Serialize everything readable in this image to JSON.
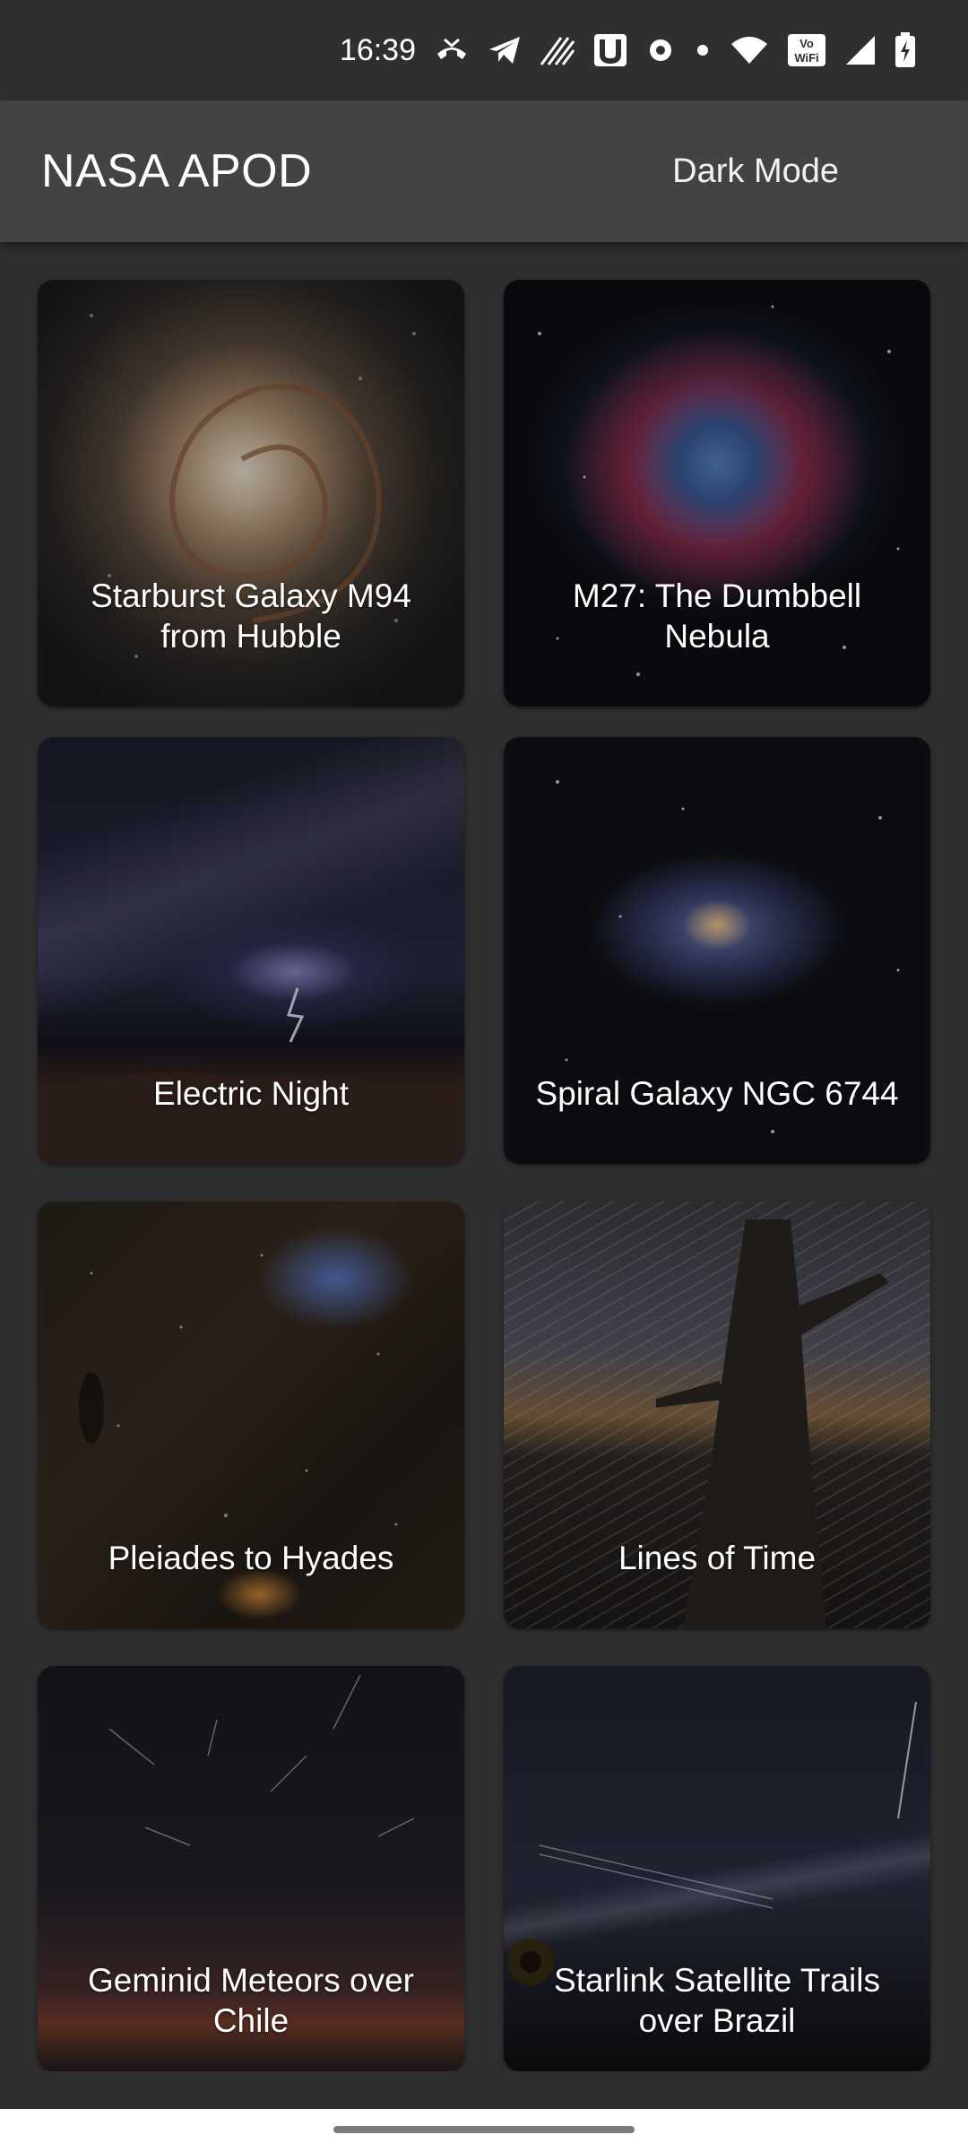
{
  "status_bar": {
    "time": "16:39",
    "icons": [
      "missed-call-icon",
      "telegram-icon",
      "signal-waves-icon",
      "u-app-icon",
      "sync-icon",
      "dot-icon",
      "wifi-icon",
      "vowifi-icon",
      "cell-signal-icon",
      "battery-charging-icon"
    ]
  },
  "app_bar": {
    "title": "NASA APOD",
    "dark_mode_label": "Dark Mode",
    "dark_mode_icon": "moon-icon"
  },
  "gallery": {
    "items": [
      {
        "title": "Starburst Galaxy M94 from Hubble"
      },
      {
        "title": "M27: The Dumbbell Nebula"
      },
      {
        "title": "Electric Night"
      },
      {
        "title": "Spiral Galaxy NGC 6744"
      },
      {
        "title": "Pleiades to Hyades"
      },
      {
        "title": "Lines of Time"
      },
      {
        "title": "Geminid Meteors over Chile"
      },
      {
        "title": "Starlink Satellite Trails over Brazil"
      }
    ]
  },
  "colors": {
    "background": "#2f2f2f",
    "app_bar": "#434343",
    "text": "#ffffff"
  }
}
